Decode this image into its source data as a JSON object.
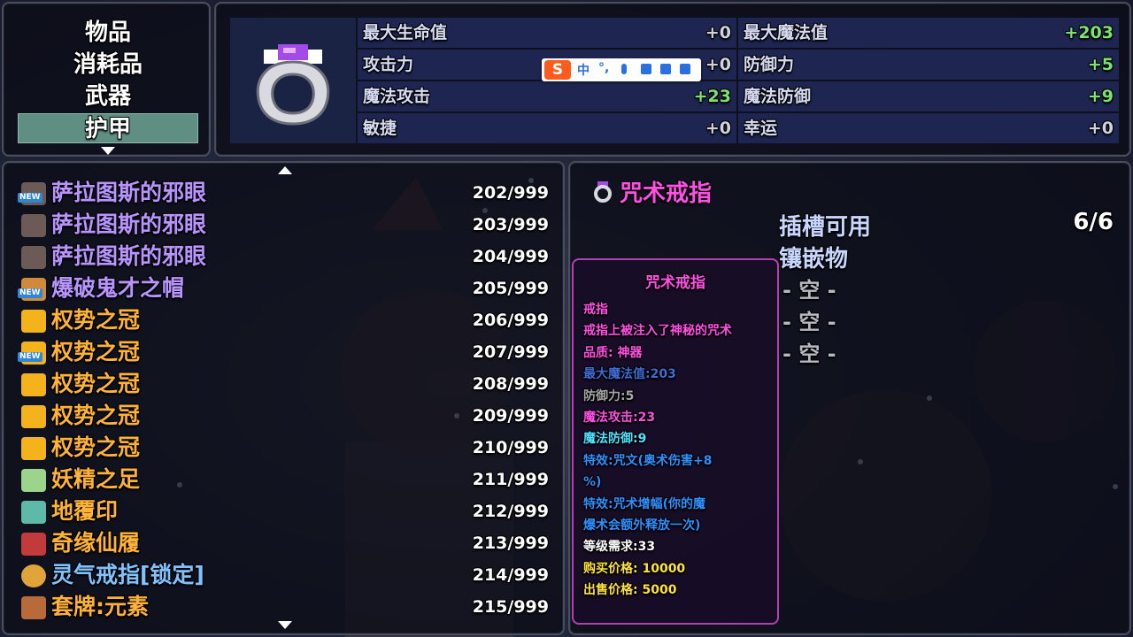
{
  "categories": {
    "items": [
      "物品",
      "消耗品",
      "武器",
      "护甲"
    ],
    "selected_index": 3
  },
  "stats": {
    "rows": [
      {
        "label": "最大生命值",
        "value": "+0",
        "positive": false
      },
      {
        "label": "最大魔法值",
        "value": "+203",
        "positive": true
      },
      {
        "label": "攻击力",
        "value": "+0",
        "positive": false
      },
      {
        "label": "防御力",
        "value": "+5",
        "positive": true
      },
      {
        "label": "魔法攻击",
        "value": "+23",
        "positive": true
      },
      {
        "label": "魔法防御",
        "value": "+9",
        "positive": true
      },
      {
        "label": "敏捷",
        "value": "+0",
        "positive": false
      },
      {
        "label": "幸运",
        "value": "+0",
        "positive": false
      }
    ]
  },
  "ime": {
    "logo": "S",
    "mode": "中",
    "punct": "°,"
  },
  "item_list": [
    {
      "name": "萨拉图斯的邪眼",
      "qty": "202/999",
      "new": true,
      "icon": "evil-eye-icon",
      "color": "#b894ff"
    },
    {
      "name": "萨拉图斯的邪眼",
      "qty": "203/999",
      "new": false,
      "icon": "evil-eye-icon",
      "color": "#b894ff"
    },
    {
      "name": "萨拉图斯的邪眼",
      "qty": "204/999",
      "new": false,
      "icon": "evil-eye-icon",
      "color": "#b894ff"
    },
    {
      "name": "爆破鬼才之帽",
      "qty": "205/999",
      "new": true,
      "icon": "hat-icon",
      "color": "#b894ff"
    },
    {
      "name": "权势之冠",
      "qty": "206/999",
      "new": false,
      "icon": "crown-icon",
      "color": "#ffb238"
    },
    {
      "name": "权势之冠",
      "qty": "207/999",
      "new": true,
      "icon": "crown-icon",
      "color": "#ffb238"
    },
    {
      "name": "权势之冠",
      "qty": "208/999",
      "new": false,
      "icon": "crown-icon",
      "color": "#ffb238"
    },
    {
      "name": "权势之冠",
      "qty": "209/999",
      "new": false,
      "icon": "crown-icon",
      "color": "#ffb238"
    },
    {
      "name": "权势之冠",
      "qty": "210/999",
      "new": false,
      "icon": "crown-icon",
      "color": "#ffb238"
    },
    {
      "name": "妖精之足",
      "qty": "211/999",
      "new": false,
      "icon": "boot-icon",
      "color": "#ffb238"
    },
    {
      "name": "地覆印",
      "qty": "212/999",
      "new": false,
      "icon": "seal-icon",
      "color": "#ffb238"
    },
    {
      "name": "奇缘仙履",
      "qty": "213/999",
      "new": false,
      "icon": "shoe-icon",
      "color": "#ffb238"
    },
    {
      "name": "灵气戒指[锁定]",
      "qty": "214/999",
      "new": false,
      "icon": "ring-icon",
      "color": "#7fc2ff"
    },
    {
      "name": "套牌:元素",
      "qty": "215/999",
      "new": false,
      "icon": "card-deck-icon",
      "color": "#ffb238"
    }
  ],
  "detail": {
    "title": "咒术戒指",
    "slots_label": "插槽可用",
    "slots_value": "6/6",
    "inlay_label": "镶嵌物",
    "empty_slots": [
      "- 空 -",
      "- 空 -",
      "- 空 -"
    ]
  },
  "description": {
    "title": "咒术戒指",
    "lines": [
      {
        "text": "戒指",
        "color": "#ff4fe5"
      },
      {
        "text": "戒指上被注入了神秘的咒术",
        "color": "#ff4fe5"
      },
      {
        "text": "品质: 神器",
        "color": "#ff4fe5"
      },
      {
        "text": "最大魔法值:203",
        "color": "#3f6bd6"
      },
      {
        "text": "防御力:5",
        "color": "#a6a6a6"
      },
      {
        "text": "魔法攻击:23",
        "color": "#ff4fe5"
      },
      {
        "text": "魔法防御:9",
        "color": "#52e0ff"
      },
      {
        "text": "特效:咒文(奥术伤害+8",
        "color": "#2f8fff"
      },
      {
        "text": "%)",
        "color": "#2f8fff"
      },
      {
        "text": "特效:咒术增幅(你的魔",
        "color": "#2f8fff"
      },
      {
        "text": "爆术会额外释放一次)",
        "color": "#2f8fff"
      },
      {
        "text": "等级需求:33",
        "color": "#ffffff"
      },
      {
        "text": "购买价格: 10000",
        "color": "#ffe23a"
      },
      {
        "text": "出售价格: 5000",
        "color": "#ffe23a"
      }
    ]
  },
  "colors": {
    "accent_selected": "#5f8f82",
    "stat_positive": "#7be36f",
    "artifact_pink": "#ff4fe5"
  }
}
